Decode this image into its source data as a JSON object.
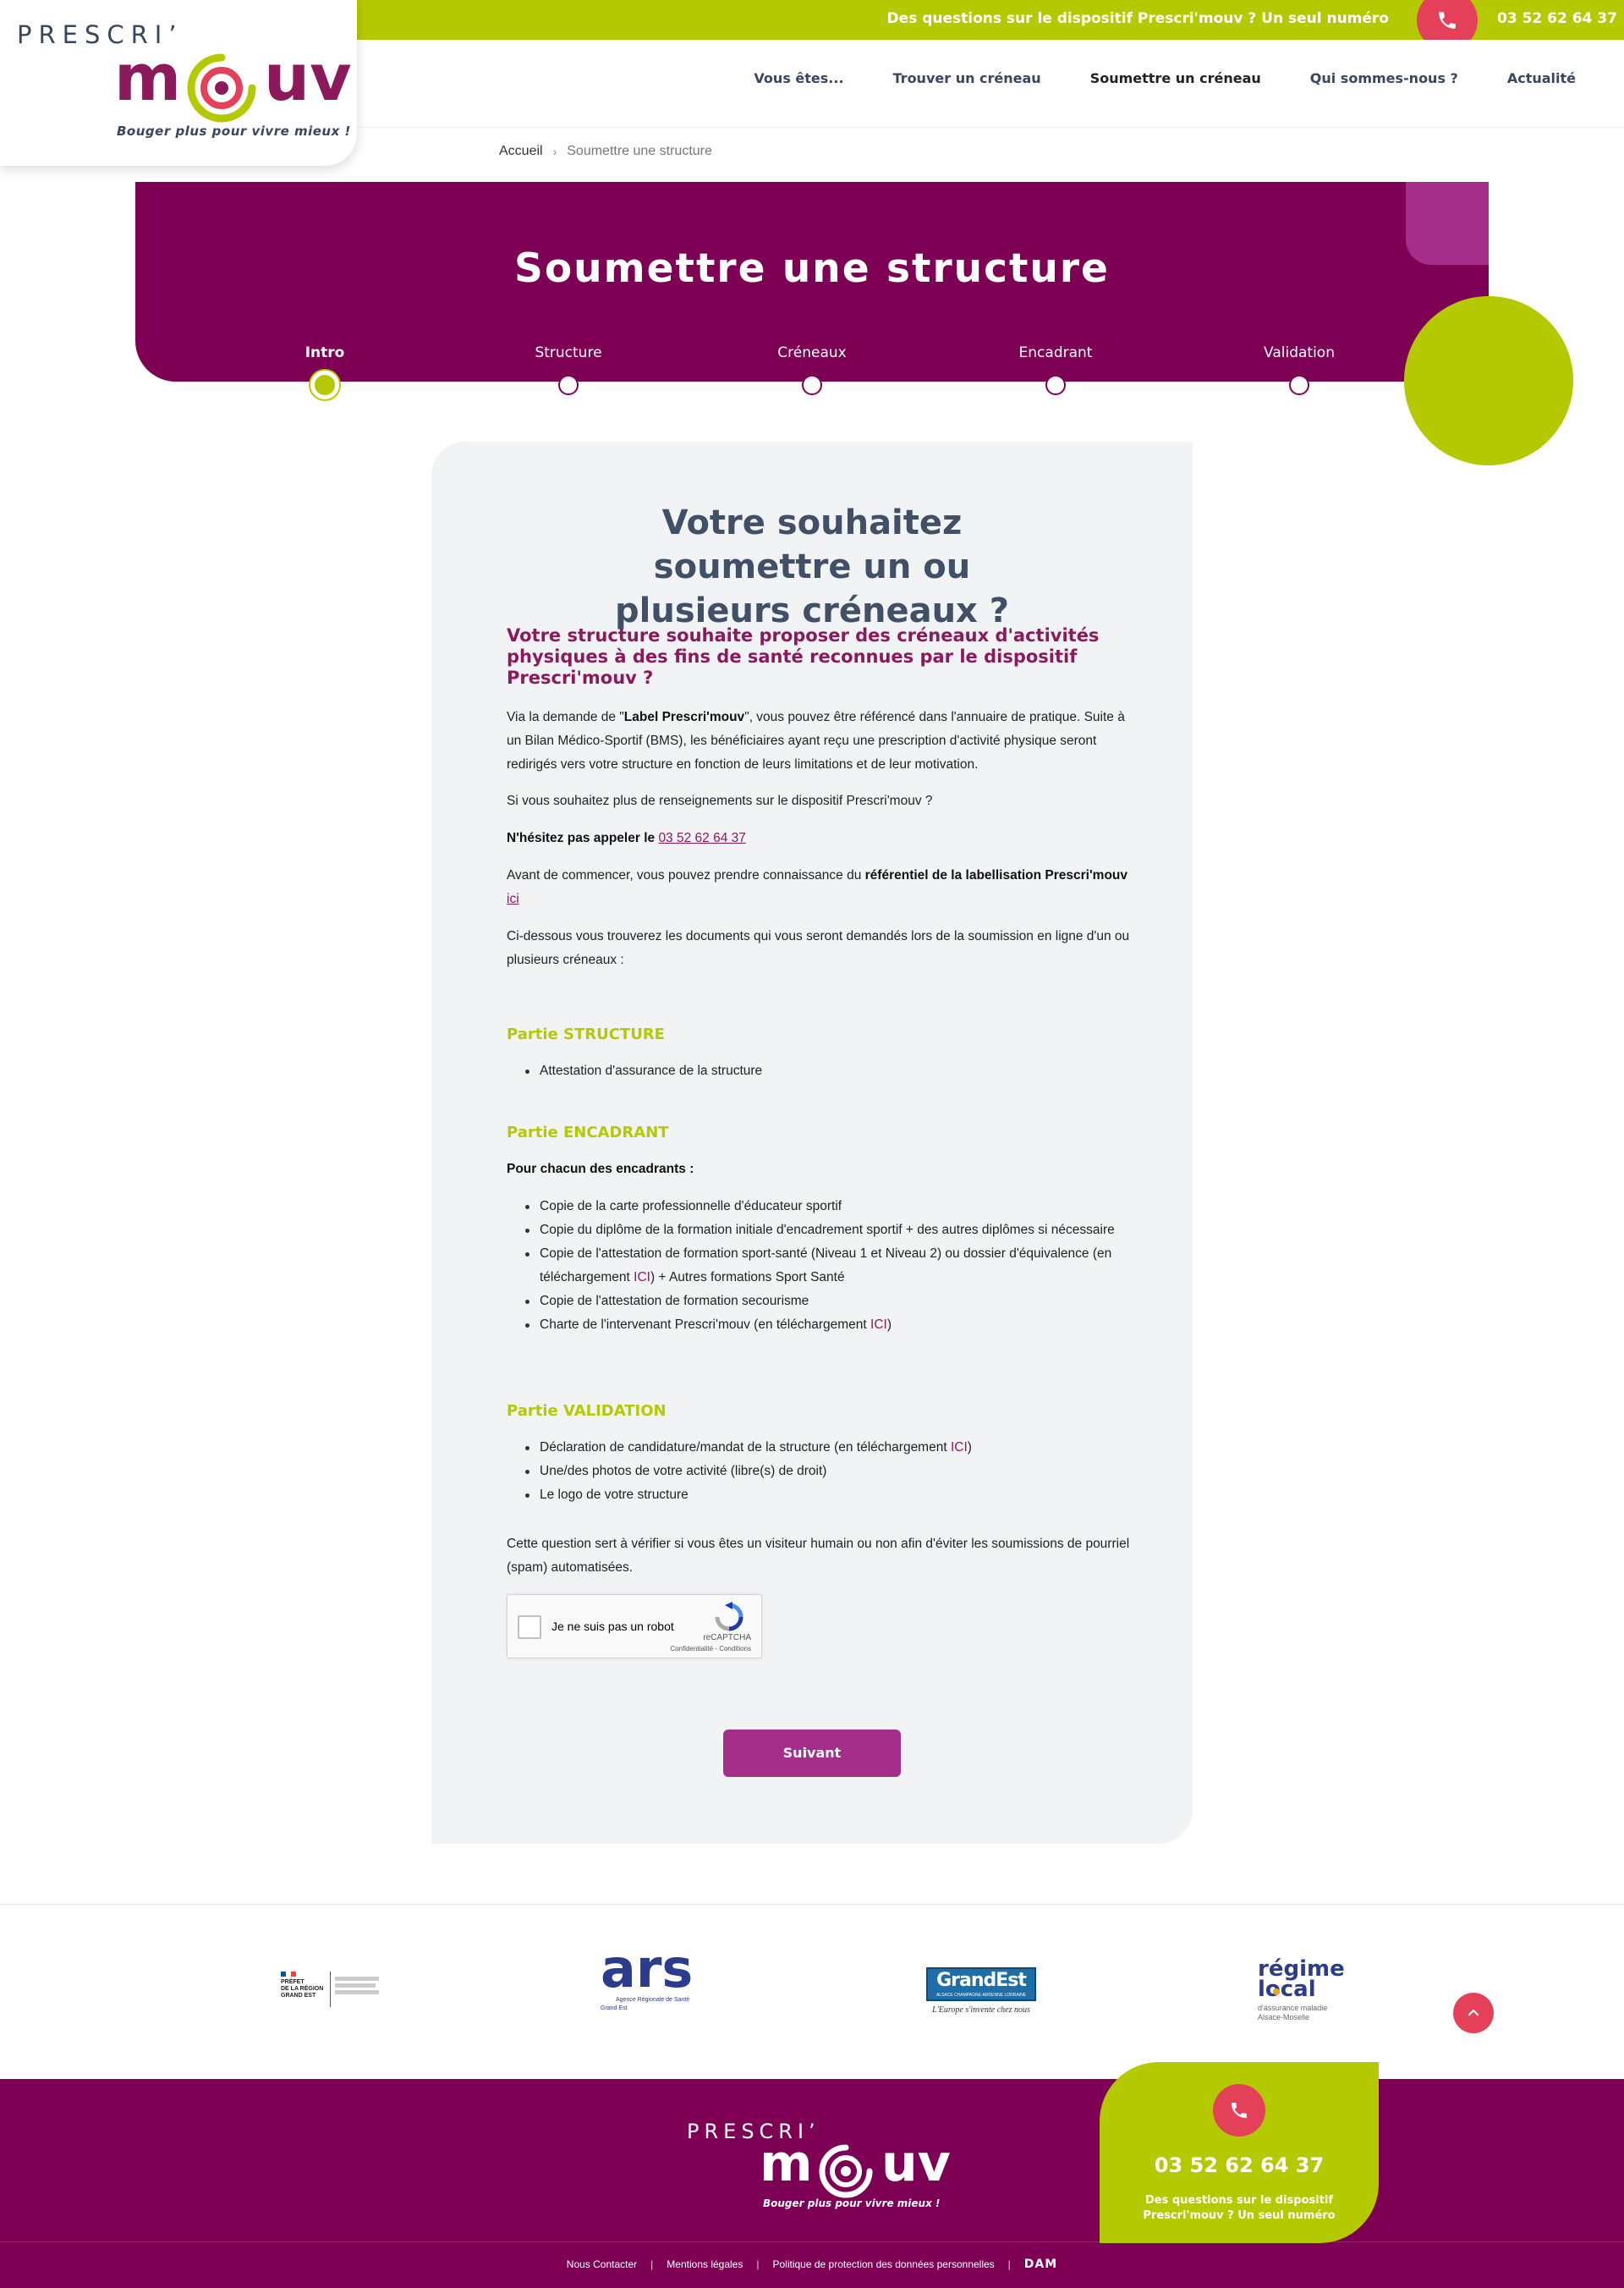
{
  "topbar": {
    "question": "Des questions sur le dispositif Prescri'mouv ? Un seul numéro",
    "phone": "03 52 62 64 37"
  },
  "logo": {
    "line1": "PRESCRI’",
    "m": "m",
    "uv": "uv",
    "tagline": "Bouger plus pour vivre mieux !"
  },
  "nav": {
    "items": [
      "Vous êtes...",
      "Trouver un créneau",
      "Soumettre un créneau",
      "Qui sommes-nous ?",
      "Actualité"
    ]
  },
  "breadcrumb": {
    "home": "Accueil",
    "separator": "›",
    "current": "Soumettre une structure"
  },
  "hero": {
    "title": "Soumettre une structure"
  },
  "steps": [
    "Intro",
    "Structure",
    "Créneaux",
    "Encadrant",
    "Validation"
  ],
  "card": {
    "title": "Votre souhaitez soumettre un ou plusieurs créneaux ?",
    "subtitle": "Votre structure souhaite proposer des créneaux d'activités physiques à des fins de santé reconnues par le dispositif Prescri'mouv ?",
    "p1_a": "Via la demande de \"",
    "p1_bold": "Label Prescri'mouv",
    "p1_b": "\", vous pouvez être référencé dans l'annuaire de pratique. Suite à un Bilan Médico-Sportif (BMS), les bénéficiaires ayant reçu une prescription d'activité physique seront redirigés vers votre structure en fonction de leurs limitations et de leur motivation.",
    "p2": "Si vous souhaitez plus de renseignements sur le dispositif Prescri'mouv  ?",
    "p3_bold": "N'hésitez pas appeler le ",
    "p3_link": "03 52 62 64 37",
    "p4_a": "Avant de commencer, vous pouvez prendre connaissance du ",
    "p4_bold": "référentiel de la labellisation Prescri'mouv",
    "p4_link": "ici",
    "p5": "Ci-dessous vous trouverez les documents qui vous seront demandés lors de la soumission en ligne d'un ou plusieurs créneaux :",
    "section_structure": "Partie STRUCTURE",
    "structure_items": [
      "Attestation d'assurance de la structure"
    ],
    "section_encadrant": "Partie ENCADRANT",
    "encadrant_intro": "Pour chacun des encadrants :",
    "enc_1": "Copie de la carte professionnelle d'éducateur sportif",
    "enc_2": "Copie du diplôme de la formation initiale d'encadrement sportif + des autres diplômes si nécessaire",
    "enc_3_a": "Copie de l'attestation de formation sport-santé (Niveau 1 et Niveau 2) ou dossier d'équivalence (en téléchargement ",
    "enc_3_link": "ICI",
    "enc_3_b": ") + Autres formations Sport Santé",
    "enc_4": "Copie de l'attestation de formation secourisme",
    "enc_5_a": "Charte de l'intervenant Prescri'mouv (en téléchargement ",
    "enc_5_link": "ICI",
    "enc_5_b": ")",
    "section_validation": "Partie VALIDATION",
    "val_1_a": "Déclaration de candidature/mandat de la structure (en téléchargement ",
    "val_1_link": "ICI",
    "val_1_b": ")",
    "val_2": "Une/des photos de votre activité (libre(s) de droit)",
    "val_3": "Le logo de votre structure",
    "captcha_note": "Cette question sert à vérifier si vous êtes un visiteur humain ou non afin d'éviter les soumissions de pourriel (spam) automatisées.",
    "recaptcha_label": "Je ne suis pas un robot",
    "recaptcha_brand": "reCAPTCHA",
    "recaptcha_links": "Confidentialité - Conditions",
    "next_button": "Suivant"
  },
  "partners": {
    "prefet_line1": "PRÉFET",
    "prefet_line2": "DE LA RÉGION",
    "prefet_line3": "GRAND EST",
    "ars_mark": "ars",
    "ars_sub": "Agence Régionale de Santé",
    "ars_sub2": "Grand Est",
    "grandest_mark": "GrandEst",
    "grandest_sub": "ALSACE CHAMPAGNE-ARDENNE LORRAINE",
    "grandest_tag": "L'Europe s'invente chez nous",
    "regime_line1": "régime",
    "regime_line2": "local",
    "regime_sub1": "d'assurance maladie",
    "regime_sub2": "Alsace-Moselle"
  },
  "footer": {
    "call_number": "03 52 62 64 37",
    "call_text": "Des questions sur le dispositif Prescri'mouv ? Un seul numéro",
    "links": [
      "Nous Contacter",
      "Mentions légales",
      "Politique de protection des données personnelles"
    ],
    "link_separator": "|",
    "agency": "DAM"
  },
  "colors": {
    "accent_green": "#b5c900",
    "brand_purple": "#7e0054",
    "button_purple": "#a52e8a",
    "phone_red": "#e4405a",
    "title_slate": "#415066"
  },
  "icons": [
    "phone-icon",
    "chevron-up-icon",
    "recaptcha-icon"
  ]
}
